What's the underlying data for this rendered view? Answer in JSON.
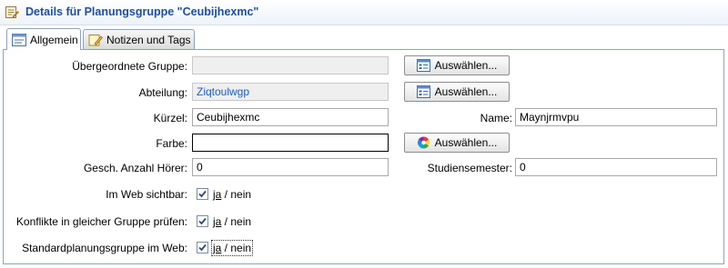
{
  "header": {
    "title": "Details für Planungsgruppe \"Ceubijhexmc\""
  },
  "tabs": [
    {
      "label": "Allgemein",
      "icon": "form-icon",
      "active": true
    },
    {
      "label": "Notizen und Tags",
      "icon": "note-pencil-icon",
      "active": false
    }
  ],
  "form": {
    "parent_group": {
      "label": "Übergeordnete Gruppe:",
      "value": "",
      "button": "Auswählen...",
      "button_icon": "list-select-icon"
    },
    "department": {
      "label": "Abteilung:",
      "value": "Ziqtoulwgp",
      "button": "Auswählen...",
      "button_icon": "list-select-icon"
    },
    "short_name": {
      "label": "Kürzel:",
      "value": "Ceubijhexmc"
    },
    "name": {
      "label": "Name:",
      "value": "Maynjrmvpu"
    },
    "color": {
      "label": "Farbe:",
      "value": "",
      "button": "Auswählen...",
      "button_icon": "color-wheel-icon"
    },
    "listeners": {
      "label": "Gesch. Anzahl Hörer:",
      "value": "0"
    },
    "semesters": {
      "label": "Studiensemester:",
      "value": "0"
    },
    "web_visible": {
      "label": "Im Web sichtbar:",
      "checked": true,
      "yes": "ja",
      "sep": " / ",
      "no": "nein"
    },
    "conflicts": {
      "label": "Konflikte in gleicher Gruppe prüfen:",
      "checked": true,
      "yes": "ja",
      "sep": " / ",
      "no": "nein"
    },
    "default_group": {
      "label": "Standardplanungsgruppe im Web:",
      "checked": true,
      "yes": "ja",
      "sep": " / ",
      "no": "nein"
    }
  },
  "colors": {
    "title": "#1e4f9c",
    "link": "#1d5fbd",
    "border": "#8ea3c0"
  }
}
